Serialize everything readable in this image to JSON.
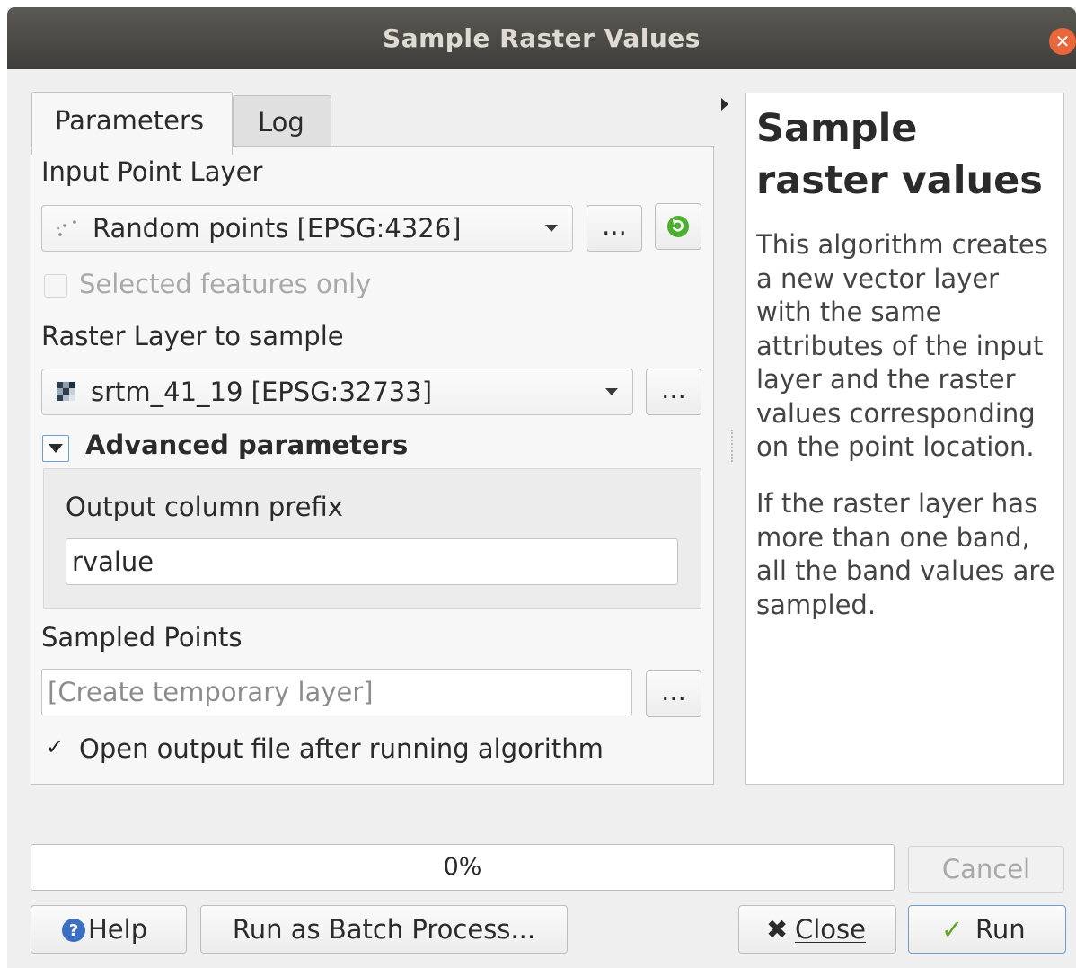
{
  "window": {
    "title": "Sample Raster Values"
  },
  "tabs": [
    {
      "label": "Parameters"
    },
    {
      "label": "Log"
    }
  ],
  "params": {
    "input_layer_label": "Input Point Layer",
    "input_layer_value": "Random points [EPSG:4326]",
    "selected_only_label": "Selected features only",
    "raster_label": "Raster Layer to sample",
    "raster_value": "srtm_41_19 [EPSG:32733]",
    "advanced_label": "Advanced parameters",
    "prefix_label": "Output column prefix",
    "prefix_value": "rvalue",
    "sampled_label": "Sampled Points",
    "sampled_placeholder": "[Create temporary layer]",
    "open_output_label": "Open output file after running algorithm",
    "ellipsis": "..."
  },
  "help": {
    "title": "Sample raster values",
    "para1": "This algorithm creates a new vector layer with the same attributes of the input layer and the raster values corresponding on the point location.",
    "para2": "If the raster layer has more than one band, all the band values are sampled."
  },
  "progress": {
    "text": "0%",
    "value": 0
  },
  "buttons": {
    "cancel": "Cancel",
    "help": "Help",
    "batch": "Run as Batch Process...",
    "close": "Close",
    "run": "Run"
  },
  "icons": {
    "close_window": "close-x-icon",
    "point_layer": "point-layer-icon",
    "raster_layer": "raster-layer-icon",
    "iterate": "iterate-icon",
    "help": "help-icon",
    "close": "close-icon",
    "run": "checkmark-icon"
  },
  "colors": {
    "titlebar": "#4a4945",
    "accent_close": "#e9673a",
    "run_border": "#6d9ed3"
  }
}
